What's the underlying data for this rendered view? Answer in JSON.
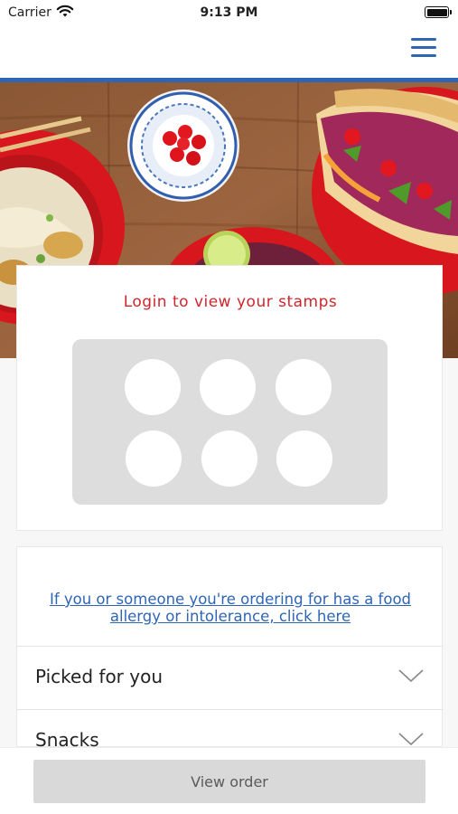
{
  "status_bar": {
    "carrier": "Carrier",
    "time": "9:13 PM",
    "icons": [
      "wifi-icon",
      "battery-icon"
    ]
  },
  "nav": {
    "menu_icon": "hamburger-menu-icon",
    "accent_color": "#2f66b4"
  },
  "hero": {
    "image": "food-spread-photo"
  },
  "stamps": {
    "title": "Login to view your stamps",
    "title_color": "#d0262b",
    "stamp_count": 6
  },
  "allergy": {
    "link_text": "If you or someone you're ordering for has a food allergy or intolerance, click here"
  },
  "categories": [
    {
      "label": "Picked for you",
      "icon": "chevron-down-icon"
    },
    {
      "label": "Snacks",
      "icon": "chevron-down-icon"
    }
  ],
  "footer": {
    "view_order_label": "View order"
  }
}
